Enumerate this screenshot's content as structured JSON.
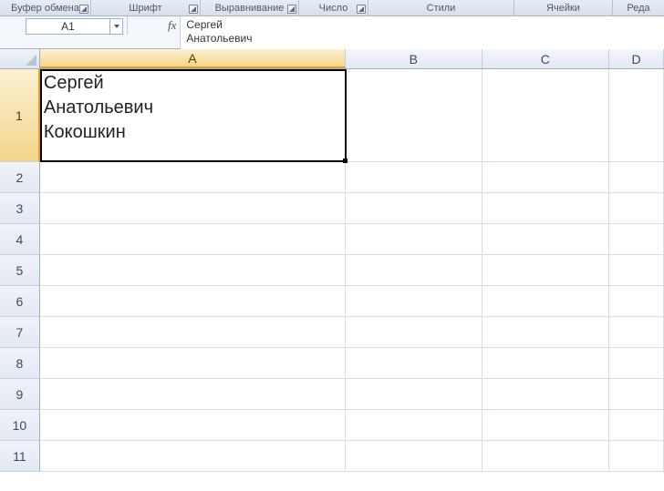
{
  "ribbon": {
    "groups": [
      {
        "label": "Буфер обмена",
        "width": 100,
        "launcher": true
      },
      {
        "label": "Шрифт",
        "width": 120,
        "launcher": true
      },
      {
        "label": "Выравнивание",
        "width": 108,
        "launcher": true
      },
      {
        "label": "Число",
        "width": 76,
        "launcher": true
      },
      {
        "label": "Стили",
        "width": 160,
        "launcher": false
      },
      {
        "label": "Ячейки",
        "width": 108,
        "launcher": false
      },
      {
        "label": "Реда",
        "width": 56,
        "launcher": false
      }
    ]
  },
  "namebox": {
    "value": "A1"
  },
  "formula_bar": {
    "fx_label": "fx",
    "content": "Сергей\nАнатольевич"
  },
  "columns": [
    "A",
    "B",
    "C",
    "D"
  ],
  "rows": [
    "1",
    "2",
    "3",
    "4",
    "5",
    "6",
    "7",
    "8",
    "9",
    "10",
    "11"
  ],
  "active": {
    "col": "A",
    "row": "1"
  },
  "cells": {
    "A1": "Сергей\nАнатольевич\nКокошкин"
  }
}
